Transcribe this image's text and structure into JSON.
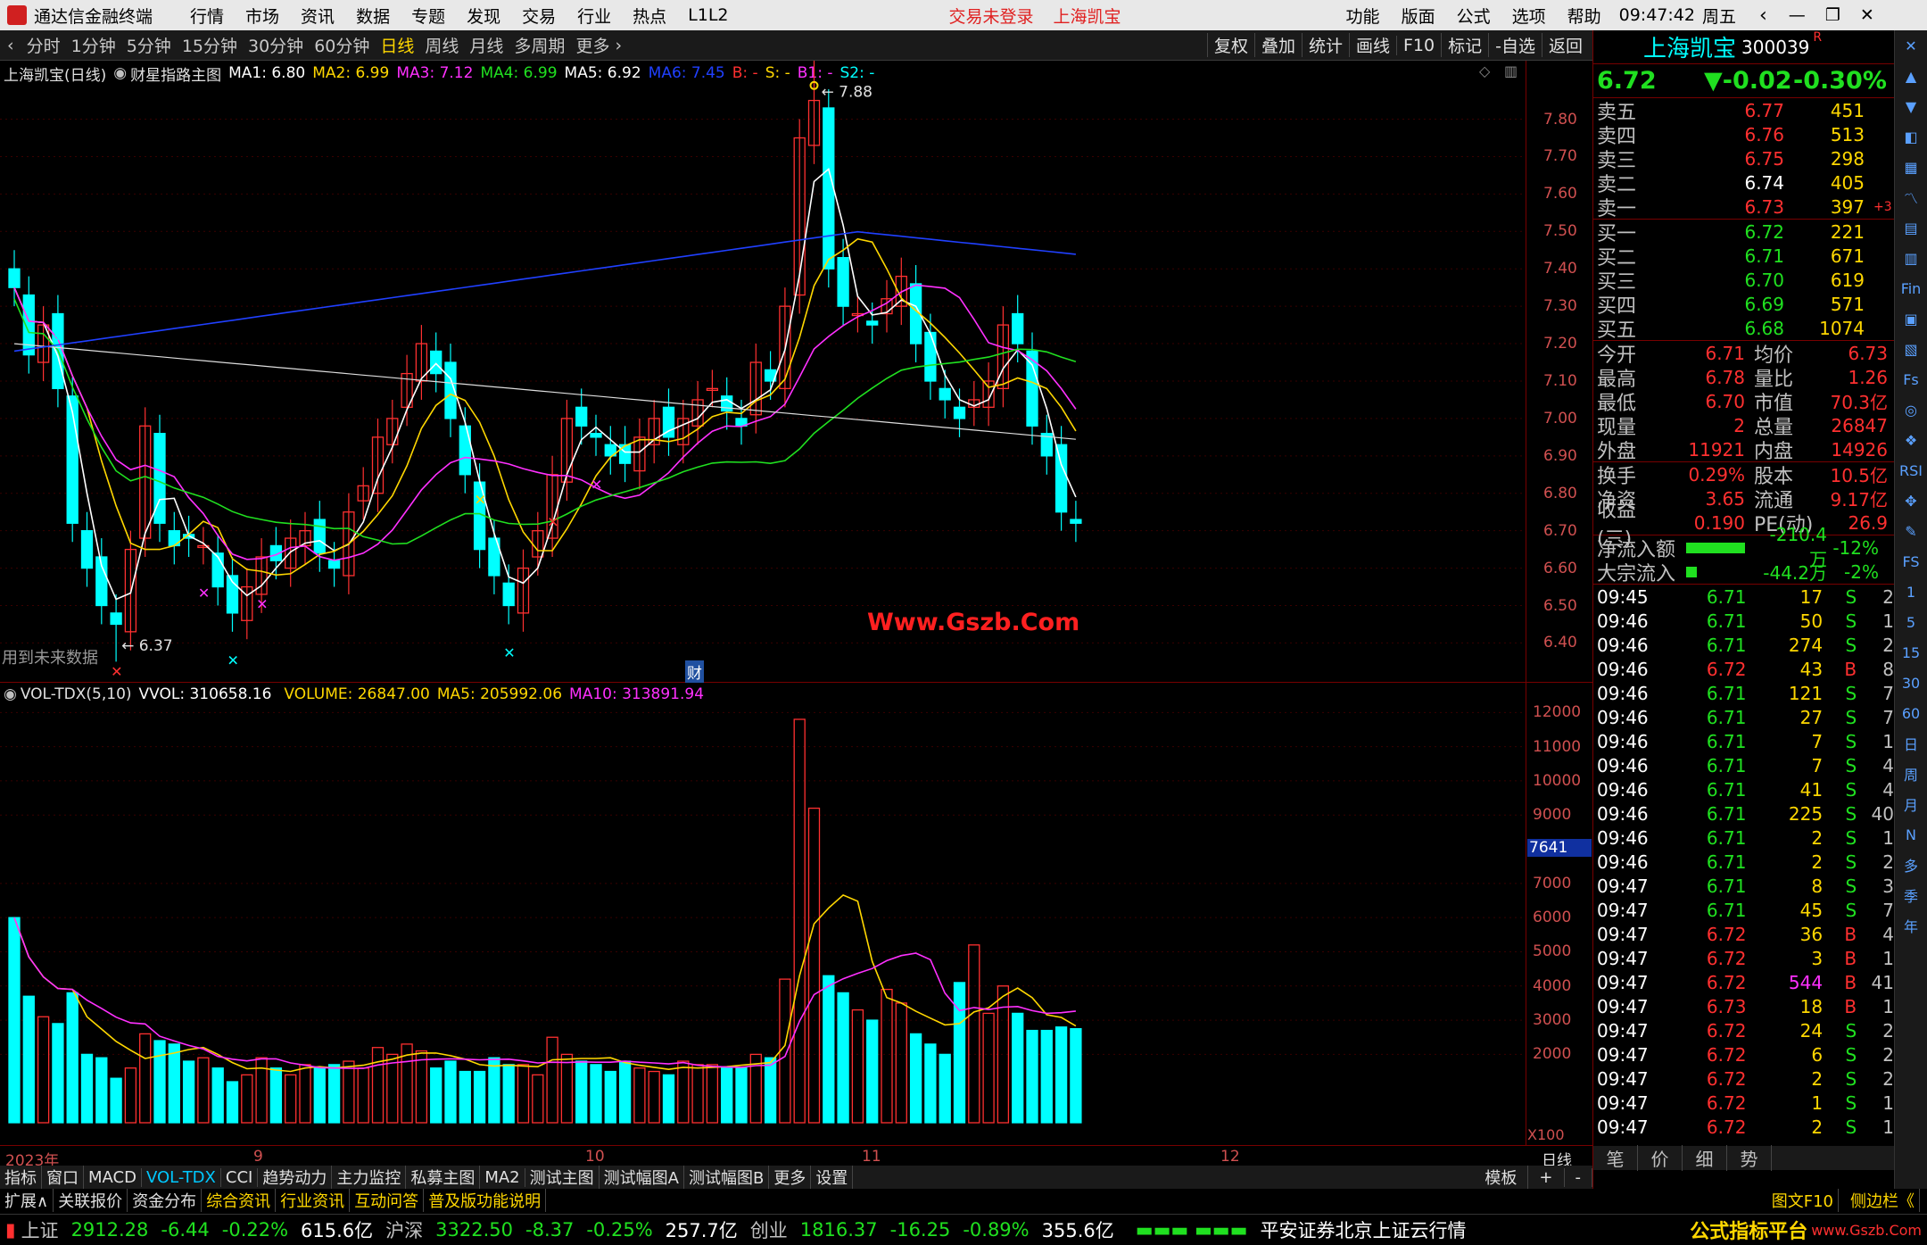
{
  "titlebar": {
    "app_name": "通达信金融终端",
    "menus": [
      "行情",
      "市场",
      "资讯",
      "数据",
      "专题",
      "发现",
      "交易",
      "行业",
      "热点",
      "L1L2"
    ],
    "login_status": "交易未登录",
    "stock_name": "上海凯宝",
    "right_menus": [
      "功能",
      "版面",
      "公式",
      "选项",
      "帮助"
    ],
    "time": "09:47:42",
    "weekday": "周五"
  },
  "periodbar": {
    "periods": [
      "分时",
      "1分钟",
      "5分钟",
      "15分钟",
      "30分钟",
      "60分钟",
      "日线",
      "周线",
      "月线",
      "多周期",
      "更多"
    ],
    "active": "日线",
    "tools": [
      "复权",
      "叠加",
      "统计",
      "画线",
      "F10",
      "标记",
      "-自选",
      "返回"
    ]
  },
  "main_chart": {
    "legend_title": "上海凯宝(日线)",
    "indicator": "财星指路主图",
    "ma": [
      {
        "label": "MA1: 6.80",
        "color": "#ffffff"
      },
      {
        "label": "MA2: 6.99",
        "color": "#ffd700"
      },
      {
        "label": "MA3: 7.12",
        "color": "#ff30ff"
      },
      {
        "label": "MA4: 6.99",
        "color": "#20e020"
      },
      {
        "label": "MA5: 6.92",
        "color": "#ffffff"
      },
      {
        "label": "MA6: 7.45",
        "color": "#2040ff"
      },
      {
        "label": "B: -",
        "color": "#ff3030"
      },
      {
        "label": "S: -",
        "color": "#ffd700"
      },
      {
        "label": "B1: -",
        "color": "#ff30ff"
      },
      {
        "label": "S2: -",
        "color": "#00ffff"
      }
    ],
    "high_label": "7.88",
    "low_label": "6.37",
    "note": "用到未来数据",
    "watermark": "Www.Gszb.Com",
    "cai_marker": "财",
    "yticks": [
      "7.80",
      "7.70",
      "7.60",
      "7.50",
      "7.40",
      "7.30",
      "7.20",
      "7.10",
      "7.00",
      "6.90",
      "6.80",
      "6.70",
      "6.60",
      "6.50",
      "6.40"
    ]
  },
  "vol_chart": {
    "legend": "VOL-TDX(5,10)",
    "vvol": "VVOL: 310658.16",
    "volume": "VOLUME: 26847.00",
    "ma5": "MA5: 205992.06",
    "ma10": "MA10: 313891.94",
    "yticks": [
      "12000",
      "11000",
      "10000",
      "9000",
      "7000",
      "6000",
      "5000",
      "4000",
      "3000",
      "2000"
    ],
    "cursor_value": "7641",
    "unit": "X100"
  },
  "xaxis": {
    "labels": [
      "2023年",
      "9",
      "10",
      "11",
      "12"
    ],
    "period": "日线"
  },
  "chart_data": {
    "type": "candlestick",
    "title": "上海凯宝(日线)",
    "ylim": [
      6.37,
      7.88
    ],
    "series": [
      {
        "name": "price",
        "values": [
          7.35,
          7.17,
          7.25,
          7.08,
          6.72,
          6.6,
          6.5,
          6.45,
          6.65,
          6.98,
          6.72,
          6.66,
          6.68,
          6.66,
          6.55,
          6.48,
          6.55,
          6.63,
          6.62,
          6.68,
          6.7,
          6.64,
          6.6,
          6.75,
          6.82,
          6.95,
          7.0,
          7.12,
          7.2,
          7.12,
          7.0,
          6.85,
          6.65,
          6.58,
          6.5,
          6.6,
          6.7,
          6.85,
          7.0,
          6.98,
          6.95,
          6.9,
          6.88,
          6.95,
          7.0,
          6.95,
          7.0,
          7.05,
          7.08,
          7.02,
          6.98,
          7.15,
          7.1,
          7.3,
          7.75,
          7.85,
          7.4,
          7.3,
          7.28,
          7.25,
          7.32,
          7.38,
          7.2,
          7.1,
          7.05,
          7.0,
          7.05,
          7.1,
          7.25,
          7.2,
          6.98,
          6.9,
          6.75,
          6.72
        ]
      },
      {
        "name": "volume",
        "values": [
          6000,
          3700,
          3100,
          2900,
          3800,
          2000,
          1900,
          1300,
          1600,
          2600,
          2400,
          2300,
          1800,
          1900,
          1600,
          1200,
          1400,
          1900,
          1600,
          1400,
          1700,
          1600,
          1700,
          1800,
          1600,
          2200,
          2000,
          2300,
          2100,
          1600,
          1800,
          1500,
          1500,
          1900,
          1700,
          1700,
          1400,
          2500,
          2000,
          1800,
          1700,
          1500,
          1800,
          1600,
          1500,
          1400,
          1800,
          1700,
          1700,
          1600,
          1600,
          2000,
          1900,
          4200,
          11800,
          9200,
          4300,
          3800,
          3300,
          3000,
          3900,
          3500,
          2600,
          2300,
          2000,
          4100,
          5200,
          3200,
          4000,
          3200,
          2700,
          2700,
          2800,
          2750
        ]
      }
    ]
  },
  "quote": {
    "name": "上海凯宝",
    "code": "300039",
    "r_mark": "R",
    "price": "6.72",
    "change": "▼-0.02",
    "pct": "-0.30%",
    "asks": [
      {
        "label": "卖五",
        "price": "6.77",
        "vol": "451"
      },
      {
        "label": "卖四",
        "price": "6.76",
        "vol": "513"
      },
      {
        "label": "卖三",
        "price": "6.75",
        "vol": "298"
      },
      {
        "label": "卖二",
        "price": "6.74",
        "vol": "405"
      },
      {
        "label": "卖一",
        "price": "6.73",
        "vol": "397",
        "extra": "+3"
      }
    ],
    "bids": [
      {
        "label": "买一",
        "price": "6.72",
        "vol": "221"
      },
      {
        "label": "买二",
        "price": "6.71",
        "vol": "671"
      },
      {
        "label": "买三",
        "price": "6.70",
        "vol": "619"
      },
      {
        "label": "买四",
        "price": "6.69",
        "vol": "571"
      },
      {
        "label": "买五",
        "price": "6.68",
        "vol": "1074"
      }
    ],
    "stats": [
      {
        "k1": "今开",
        "v1": "6.71",
        "k2": "均价",
        "v2": "6.73"
      },
      {
        "k1": "最高",
        "v1": "6.78",
        "k2": "量比",
        "v2": "1.26"
      },
      {
        "k1": "最低",
        "v1": "6.70",
        "k2": "市值",
        "v2": "70.3亿"
      },
      {
        "k1": "现量",
        "v1": "2",
        "k2": "总量",
        "v2": "26847"
      },
      {
        "k1": "外盘",
        "v1": "11921",
        "k2": "内盘",
        "v2": "14926"
      }
    ],
    "stats2": [
      {
        "k1": "换手",
        "v1": "0.29%",
        "k2": "股本",
        "v2": "10.5亿"
      },
      {
        "k1": "净资",
        "v1": "3.65",
        "k2": "流通",
        "v2": "9.17亿"
      },
      {
        "k1": "收益(三)",
        "v1": "0.190",
        "k2": "PE(动)",
        "v2": "26.9"
      }
    ],
    "flow": [
      {
        "label": "净流入额",
        "value": "-210.4万",
        "pct": "-12%"
      },
      {
        "label": "大宗流入",
        "value": "-44.2万",
        "pct": "-2%"
      }
    ],
    "ticks": [
      [
        "09:45",
        "6.71",
        "17",
        "S",
        "2"
      ],
      [
        "09:46",
        "6.71",
        "50",
        "S",
        "1"
      ],
      [
        "09:46",
        "6.71",
        "274",
        "S",
        "2"
      ],
      [
        "09:46",
        "6.72",
        "43",
        "B",
        "8"
      ],
      [
        "09:46",
        "6.71",
        "121",
        "S",
        "7"
      ],
      [
        "09:46",
        "6.71",
        "27",
        "S",
        "7"
      ],
      [
        "09:46",
        "6.71",
        "7",
        "S",
        "1"
      ],
      [
        "09:46",
        "6.71",
        "7",
        "S",
        "4"
      ],
      [
        "09:46",
        "6.71",
        "41",
        "S",
        "4"
      ],
      [
        "09:46",
        "6.71",
        "225",
        "S",
        "40"
      ],
      [
        "09:46",
        "6.71",
        "2",
        "S",
        "1"
      ],
      [
        "09:46",
        "6.71",
        "2",
        "S",
        "2"
      ],
      [
        "09:47",
        "6.71",
        "8",
        "S",
        "3"
      ],
      [
        "09:47",
        "6.71",
        "45",
        "S",
        "7"
      ],
      [
        "09:47",
        "6.72",
        "36",
        "B",
        "4"
      ],
      [
        "09:47",
        "6.72",
        "3",
        "B",
        "1"
      ],
      [
        "09:47",
        "6.72",
        "544",
        "B",
        "41"
      ],
      [
        "09:47",
        "6.73",
        "18",
        "B",
        "1"
      ],
      [
        "09:47",
        "6.72",
        "24",
        "S",
        "2"
      ],
      [
        "09:47",
        "6.72",
        "6",
        "S",
        "2"
      ],
      [
        "09:47",
        "6.72",
        "2",
        "S",
        "2"
      ],
      [
        "09:47",
        "6.72",
        "1",
        "S",
        "1"
      ],
      [
        "09:47",
        "6.72",
        "2",
        "S",
        "1"
      ]
    ],
    "bottom_tabs": [
      "笔",
      "价",
      "细",
      "势"
    ]
  },
  "tools": [
    "✕",
    "▲",
    "▼",
    "◧",
    "▦",
    "〽",
    "▤",
    "▥",
    "Fin",
    "▣",
    "▧",
    "Fs",
    "◎",
    "❖",
    "RSI",
    "✥",
    "✎",
    "FS",
    "1",
    "5",
    "15",
    "30",
    "60",
    "日",
    "周",
    "月",
    "N",
    "多",
    "季",
    "年"
  ],
  "tabs1": [
    "指标",
    "窗口",
    "MACD",
    "VOL-TDX",
    "CCI",
    "趋势动力",
    "主力监控",
    "私募主图",
    "MA2",
    "测试主图",
    "测试幅图A",
    "测试幅图B",
    "更多",
    "设置"
  ],
  "tabs1_right": [
    "模板",
    "+",
    "-"
  ],
  "tabs2": [
    "扩展∧",
    "关联报价",
    "资金分布",
    "综合资讯",
    "行业资讯",
    "互动问答",
    "普及版功能说明"
  ],
  "tabs2_right": [
    "图文F10",
    "侧边栏《"
  ],
  "status": {
    "indices": [
      {
        "name": "上证",
        "value": "2912.28",
        "chg": "-6.44",
        "pct": "-0.22%",
        "amt": "615.6亿"
      },
      {
        "name": "沪深",
        "value": "3322.50",
        "chg": "-8.37",
        "pct": "-0.25%",
        "amt": "257.7亿"
      },
      {
        "name": "创业",
        "value": "1816.37",
        "chg": "-16.25",
        "pct": "-0.89%",
        "amt": "355.6亿"
      }
    ],
    "server": "平安证券北京上证云行情",
    "brand": "公式指标平台",
    "brand_url": "www.Gszb.Com"
  }
}
